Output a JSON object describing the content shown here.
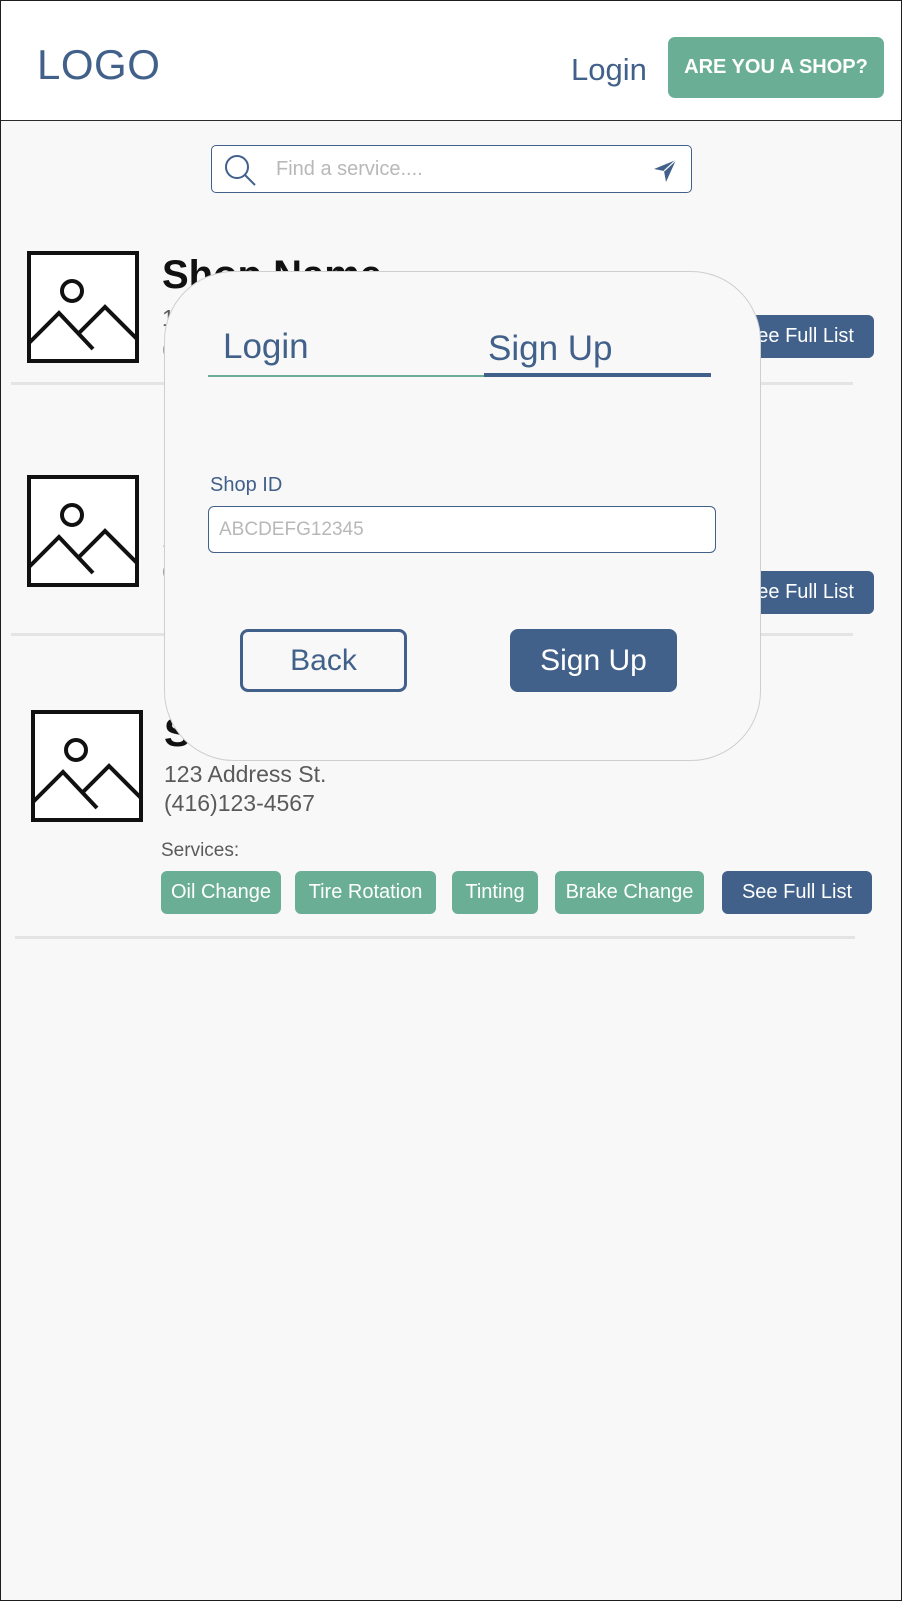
{
  "header": {
    "logo": "LOGO",
    "login_label": "Login",
    "shop_cta_label": "ARE YOU A SHOP?"
  },
  "search": {
    "placeholder": "Find a service...."
  },
  "shops": [
    {
      "name": "Shop Name",
      "address_partial": "1",
      "phone_partial": "(",
      "full_list_partial": "ee Full List"
    },
    {
      "name_partial": "",
      "address_partial": "1",
      "phone_partial": "(",
      "full_list_partial": "ee Full List"
    },
    {
      "name_partial": "S",
      "address": "123 Address St.",
      "phone": "(416)123-4567",
      "services_label": "Services:",
      "services": [
        "Oil Change",
        "Tire Rotation",
        "Tinting",
        "Brake Change"
      ],
      "full_list_label": "See Full List"
    }
  ],
  "modal": {
    "tabs": [
      {
        "label": "Login",
        "active": false
      },
      {
        "label": "Sign Up",
        "active": true
      }
    ],
    "shop_id_label": "Shop ID",
    "shop_id_placeholder": "ABCDEFG12345",
    "back_label": "Back",
    "signup_label": "Sign Up"
  },
  "colors": {
    "primary": "#41608a",
    "accent": "#6aaf95",
    "background": "#f8f8f8"
  },
  "icons": {
    "search": "search-icon",
    "send": "send-icon",
    "image_placeholder": "image-placeholder-icon"
  }
}
